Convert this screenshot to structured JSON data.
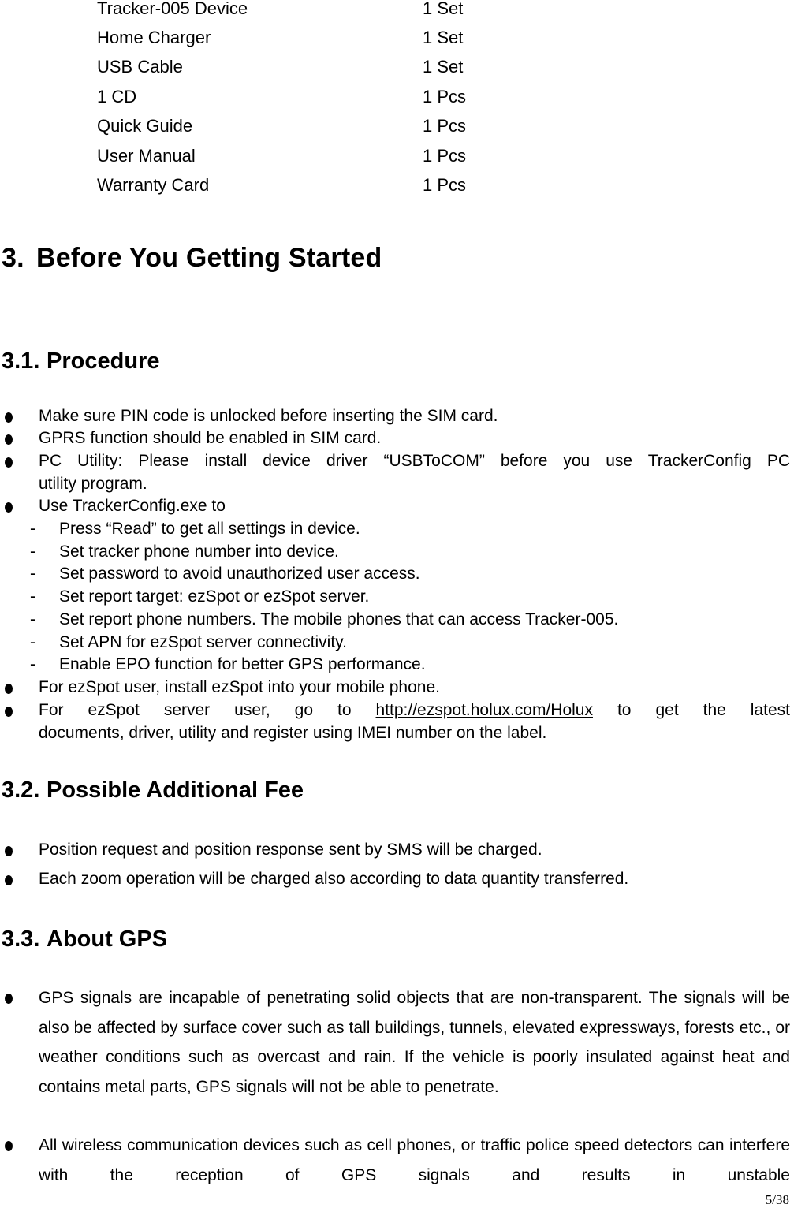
{
  "package_contents": [
    {
      "item": "Tracker-005 Device",
      "qty": "1 Set"
    },
    {
      "item": "Home Charger",
      "qty": "1 Set"
    },
    {
      "item": "USB Cable",
      "qty": "1 Set"
    },
    {
      "item": "1 CD",
      "qty": "1 Pcs"
    },
    {
      "item": "Quick Guide",
      "qty": "1 Pcs"
    },
    {
      "item": "User Manual",
      "qty": "1 Pcs"
    },
    {
      "item": "Warranty Card",
      "qty": "1 Pcs"
    }
  ],
  "section3": {
    "number": "3.",
    "title": "Before You Getting Started"
  },
  "section3_1": {
    "number": "3.1.",
    "title": "Procedure",
    "bullets": [
      "Make sure PIN code is unlocked before inserting the SIM card.",
      "GPRS function should be enabled in SIM card.",
      "PC Utility: Please install device driver “USBToCOM” before you use TrackerConfig PC",
      "utility program.",
      "Use TrackerConfig.exe to"
    ],
    "sub_items": [
      "Press “Read” to get all settings in device.",
      "Set tracker phone number into device.",
      "Set password to avoid unauthorized user access.",
      "Set report target: ezSpot or ezSpot server.",
      "Set report phone numbers. The mobile phones that can access Tracker-005.",
      "Set APN for ezSpot server connectivity.",
      "Enable EPO function for better GPS performance."
    ],
    "dash": "-",
    "ezspot_user": "For ezSpot user, install ezSpot into your mobile phone.",
    "server_user": {
      "before": "For ezSpot server user, go to",
      "link": "http://ezspot.holux.com/Holux",
      "after": "to get the latest",
      "line2": "documents, driver, utility and register using IMEI number on the label."
    }
  },
  "section3_2": {
    "number": "3.2.",
    "title": "Possible Additional Fee",
    "bullets": [
      "Position request and position response sent by SMS will be charged.",
      "Each zoom operation will be charged also according to data quantity transferred."
    ]
  },
  "section3_3": {
    "number": "3.3.",
    "title": "About GPS",
    "bullets": [
      "GPS signals are incapable of penetrating solid objects that are non-transparent. The signals will be also be affected by surface cover such as tall buildings, tunnels, elevated expressways, forests etc., or weather conditions such as overcast and rain. If the vehicle is poorly insulated against heat and contains metal parts, GPS signals will not be able to penetrate.",
      "All wireless communication devices such as cell phones, or traffic police speed detectors can interfere with the reception of GPS signals and results in unstable"
    ]
  },
  "page_number": "5/38"
}
